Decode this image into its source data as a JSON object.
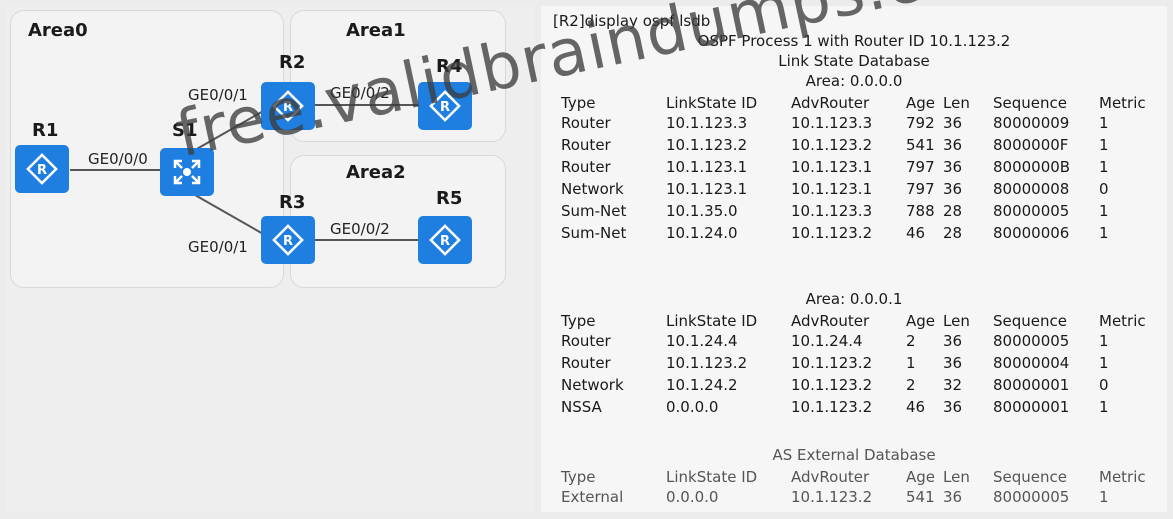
{
  "topology": {
    "areas": {
      "area0": "Area0",
      "area1": "Area1",
      "area2": "Area2"
    },
    "devices": {
      "r1": "R1",
      "r2": "R2",
      "r3": "R3",
      "r4": "R4",
      "r5": "R5",
      "s1": "S1"
    },
    "interfaces": {
      "r1_s1": "GE0/0/0",
      "s1_r2": "GE0/0/1",
      "r2_r4": "GE0/0/2",
      "s1_r3": "GE0/0/1",
      "r3_r5": "GE0/0/2"
    },
    "router_icon": "router-icon",
    "switch_icon": "switch-icon",
    "device_color": "#1f7fe0"
  },
  "lsdb": {
    "command": "[R2]display ospf lsdb",
    "process_line": "OSPF Process 1 with Router ID 10.1.123.2",
    "db_title": "Link State Database",
    "headers": [
      "Type",
      "LinkState ID",
      "AdvRouter",
      "Age",
      "Len",
      "Sequence",
      "Metric"
    ],
    "area0": {
      "title": "Area: 0.0.0.0",
      "rows": [
        [
          "Router",
          "10.1.123.3",
          "10.1.123.3",
          "792",
          "36",
          "80000009",
          "1"
        ],
        [
          "Router",
          "10.1.123.2",
          "10.1.123.2",
          "541",
          "36",
          "8000000F",
          "1"
        ],
        [
          "Router",
          "10.1.123.1",
          "10.1.123.1",
          "797",
          "36",
          "8000000B",
          "1"
        ],
        [
          "Network",
          "10.1.123.1",
          "10.1.123.1",
          "797",
          "36",
          "80000008",
          "0"
        ],
        [
          "Sum-Net",
          "10.1.35.0",
          "10.1.123.3",
          "788",
          "28",
          "80000005",
          "1"
        ],
        [
          "Sum-Net",
          "10.1.24.0",
          "10.1.123.2",
          "46",
          "28",
          "80000006",
          "1"
        ]
      ]
    },
    "area1": {
      "title": "Area: 0.0.0.1",
      "rows": [
        [
          "Router",
          "10.1.24.4",
          "10.1.24.4",
          "2",
          "36",
          "80000005",
          "1"
        ],
        [
          "Router",
          "10.1.123.2",
          "10.1.123.2",
          "1",
          "36",
          "80000004",
          "1"
        ],
        [
          "Network",
          "10.1.24.2",
          "10.1.123.2",
          "2",
          "32",
          "80000001",
          "0"
        ],
        [
          "NSSA",
          "0.0.0.0",
          "10.1.123.2",
          "46",
          "36",
          "80000001",
          "1"
        ]
      ]
    },
    "external": {
      "title": "AS External Database",
      "rows": [
        [
          "External",
          "0.0.0.0",
          "10.1.123.2",
          "541",
          "36",
          "80000005",
          "1"
        ]
      ]
    }
  },
  "watermark": "free.validbraindumps.com"
}
